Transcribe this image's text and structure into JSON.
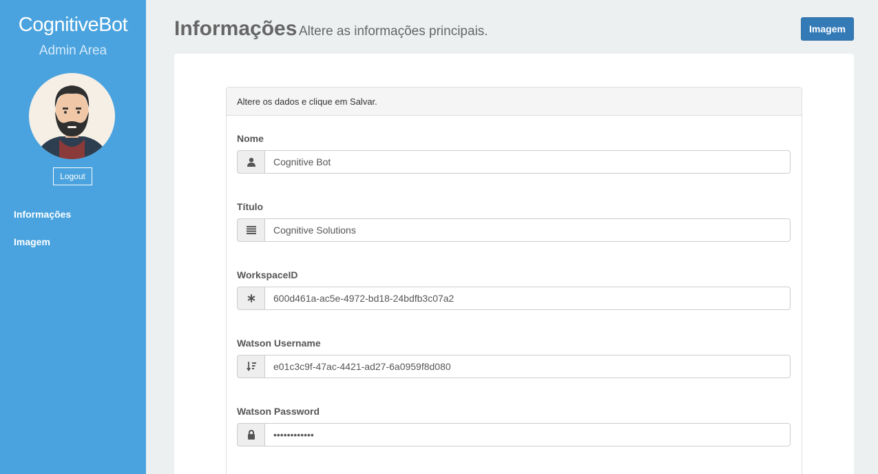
{
  "sidebar": {
    "brand": "CognitiveBot",
    "subtitle": "Admin Area",
    "logout_label": "Logout",
    "nav": [
      {
        "label": "Informações"
      },
      {
        "label": "Imagem"
      }
    ]
  },
  "header": {
    "title": "Informações",
    "subtitle": "Altere as informações principais.",
    "image_button": "Imagem"
  },
  "panel": {
    "heading": "Altere os dados e clique em Salvar."
  },
  "form": {
    "fields": [
      {
        "label": "Nome",
        "value": "Cognitive Bot",
        "icon": "user-icon"
      },
      {
        "label": "Título",
        "value": "Cognitive Solutions",
        "icon": "list-icon"
      },
      {
        "label": "WorkspaceID",
        "value": "600d461a-ac5e-4972-bd18-24bdfb3c07a2",
        "icon": "asterisk-icon"
      },
      {
        "label": "Watson Username",
        "value": "e01c3c9f-47ac-4421-ad27-6a0959f8d080",
        "icon": "sort-icon"
      },
      {
        "label": "Watson Password",
        "value": "••••••••••••",
        "icon": "lock-icon"
      }
    ]
  },
  "colors": {
    "sidebar": "#4aa3df",
    "primary_button": "#337ab7",
    "background": "#ecf0f1"
  }
}
